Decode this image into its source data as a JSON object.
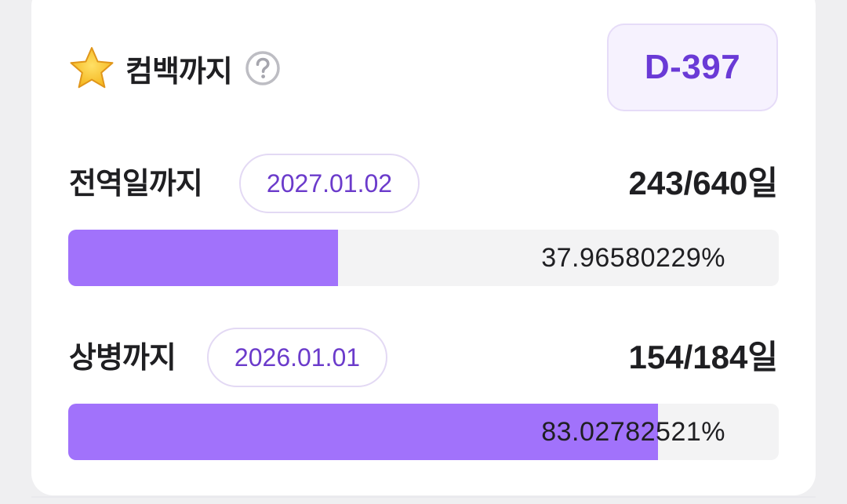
{
  "header": {
    "title": "컴백까지",
    "star_icon": "star-icon",
    "help_icon": "question-circle-icon",
    "dday": "D-397"
  },
  "rows": [
    {
      "label": "전역일까지",
      "date": "2027.01.02",
      "days": "243/640",
      "unit": "일",
      "percent_text": "37.96580229%",
      "progress": 0.3797
    },
    {
      "label": "상병까지",
      "date": "2026.01.01",
      "days": "154/184",
      "unit": "일",
      "percent_text": "83.02782521%",
      "progress": 0.8303
    }
  ],
  "colors": {
    "accent": "#6a3ad6",
    "bar_fill": "#a172fb",
    "bar_track": "#f3f3f4",
    "badge_bg": "#f6f2fe"
  }
}
